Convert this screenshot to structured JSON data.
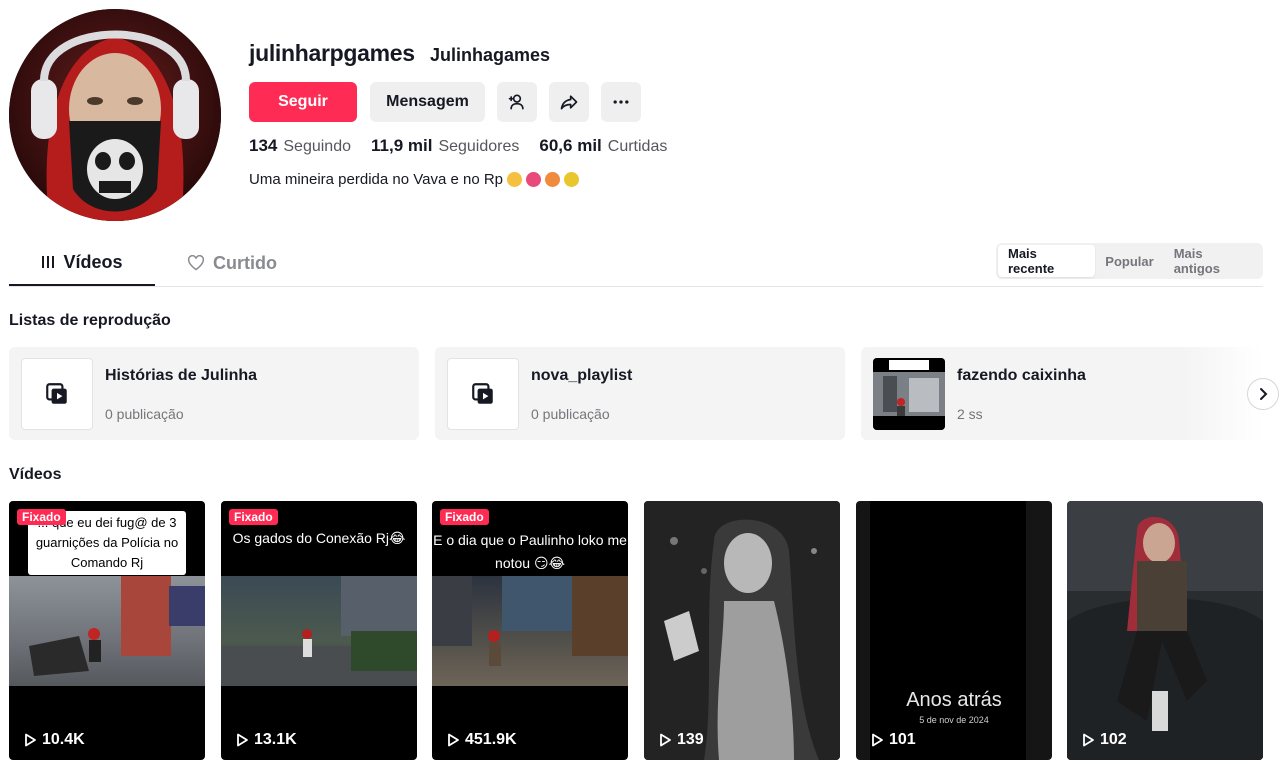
{
  "profile": {
    "username": "julinharpgames",
    "nickname": "Julinhagames",
    "follow_label": "Seguir",
    "message_label": "Mensagem",
    "stats": [
      {
        "value": "134",
        "label": "Seguindo"
      },
      {
        "value": "11,9 mil",
        "label": "Seguidores"
      },
      {
        "value": "60,6 mil",
        "label": "Curtidas"
      }
    ],
    "bio": "Uma mineira perdida no Vava e no Rp"
  },
  "tabs": {
    "videos": "Vídeos",
    "liked": "Curtido"
  },
  "sort": {
    "options": [
      "Mais recente",
      "Popular",
      "Mais antigos"
    ],
    "active": "Mais recente"
  },
  "playlists_section": {
    "title": "Listas de reprodução",
    "items": [
      {
        "name": "Histórias de Julinha",
        "count": "0 publicação"
      },
      {
        "name": "nova_playlist",
        "count": "0 publicação"
      },
      {
        "name": "fazendo caixinha",
        "count": "2 ss"
      }
    ]
  },
  "videos_section": {
    "title": "Vídeos",
    "pinned_label": "Fixado",
    "items": [
      {
        "caption": "... que eu dei fug@ de 3 guarnições da Polícia no Comando Rj",
        "views": "10.4K",
        "pinned": true
      },
      {
        "caption": "Os gados do Conexão Rj😂",
        "views": "13.1K",
        "pinned": true
      },
      {
        "caption": "E o dia que o Paulinho loko me notou 😏😂",
        "views": "451.9K",
        "pinned": true
      },
      {
        "caption": "",
        "views": "139",
        "pinned": false
      },
      {
        "caption": "Anos atrás",
        "subcaption": "5 de nov de 2024",
        "views": "101",
        "pinned": false
      },
      {
        "caption": "",
        "views": "102",
        "pinned": false
      }
    ]
  },
  "colors": {
    "accent": "#fe2c55",
    "button_bg": "#efeff0",
    "text": "#161823",
    "muted": "#75767b"
  }
}
